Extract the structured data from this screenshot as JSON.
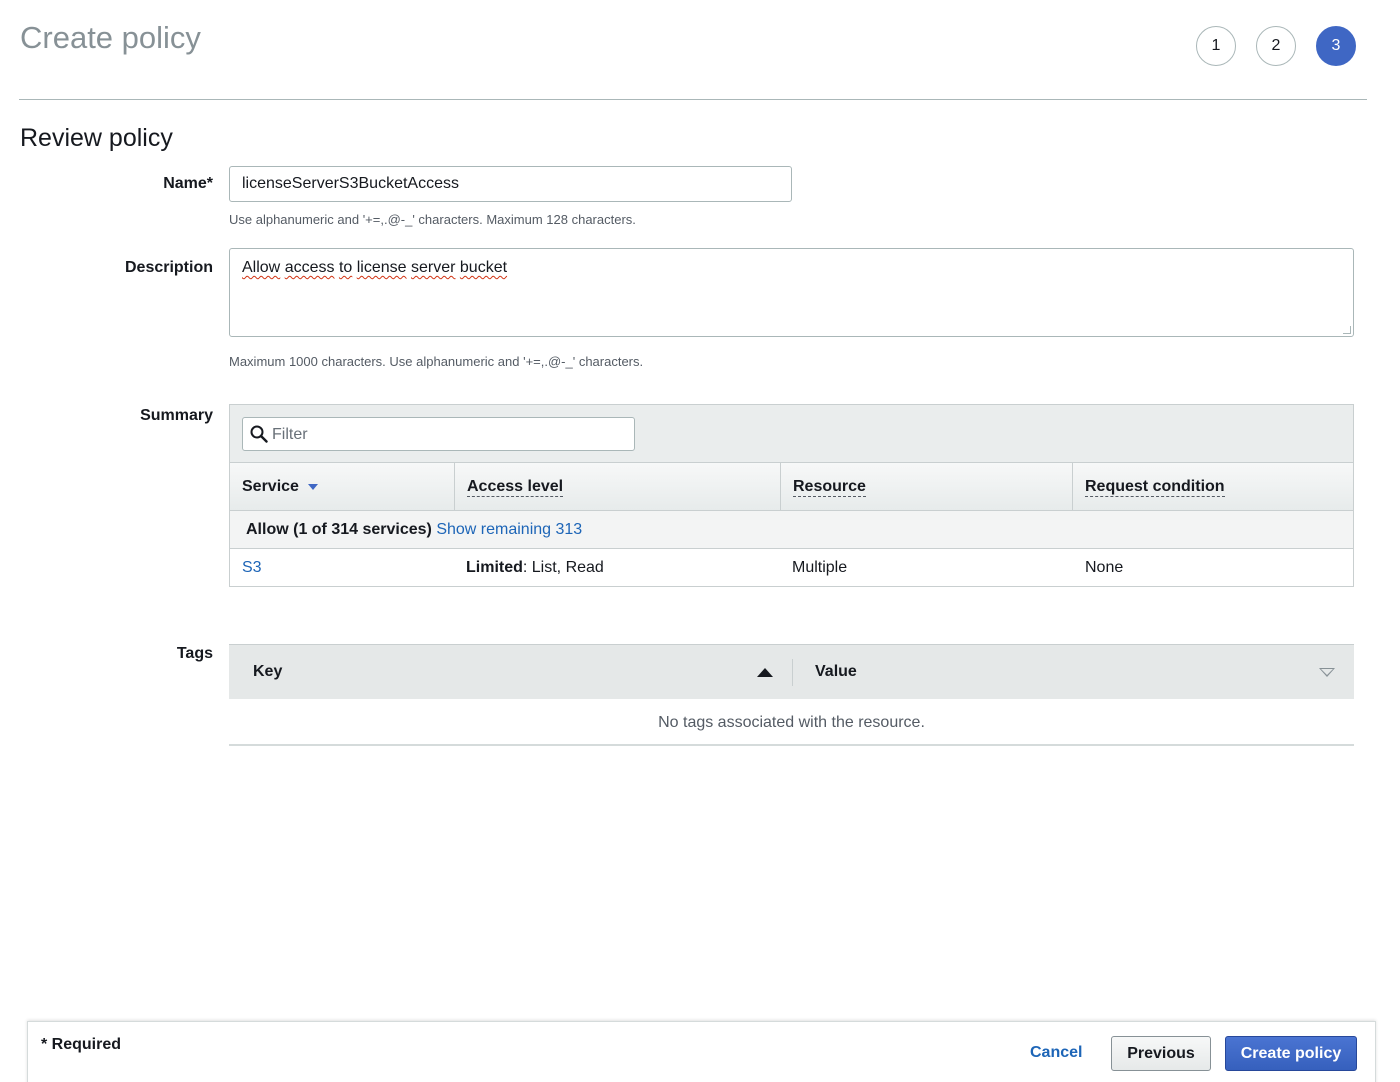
{
  "header": {
    "title": "Create policy",
    "steps": [
      {
        "label": "1",
        "active": false
      },
      {
        "label": "2",
        "active": false
      },
      {
        "label": "3",
        "active": true
      }
    ]
  },
  "section_title": "Review policy",
  "form": {
    "name_label": "Name*",
    "name_value": "licenseServerS3BucketAccess",
    "name_hint": "Use alphanumeric and '+=,.@-_' characters. Maximum 128 characters.",
    "description_label": "Description",
    "description_words": [
      "Allow",
      "access",
      "to",
      "license",
      "server",
      "bucket"
    ],
    "description_hint": "Maximum 1000 characters. Use alphanumeric and '+=,.@-_' characters.",
    "summary_label": "Summary",
    "tags_label": "Tags"
  },
  "summary": {
    "filter_placeholder": "Filter",
    "columns": [
      "Service",
      "Access level",
      "Resource",
      "Request condition"
    ],
    "allow_text": "Allow (1 of 314 services)",
    "show_remaining": "Show remaining 313",
    "rows": [
      {
        "service": "S3",
        "access_prefix": "Limited",
        "access_rest": ": List, Read",
        "resource": "Multiple",
        "request_condition": "None"
      }
    ]
  },
  "tags": {
    "key_header": "Key",
    "value_header": "Value",
    "empty_text": "No tags associated with the resource."
  },
  "footer": {
    "required_note": "* Required",
    "cancel": "Cancel",
    "previous": "Previous",
    "create": "Create policy"
  },
  "colors": {
    "accent": "#3f67c4",
    "link": "#1d65b7",
    "primary_button": "#3660bd",
    "spellcheck_underline": "#d13212"
  }
}
